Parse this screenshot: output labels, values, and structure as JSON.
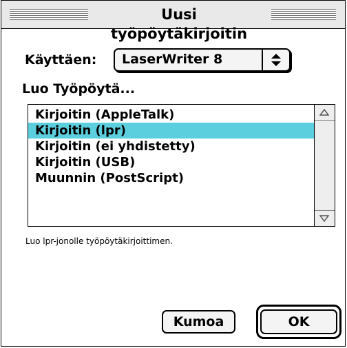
{
  "window": {
    "title": "Uusi työpöytäkirjoitin"
  },
  "using": {
    "label": "Käyttäen:",
    "selected": "LaserWriter 8"
  },
  "create": {
    "label": "Luo Työpöytä..."
  },
  "printer_types": {
    "items": [
      {
        "label": "Kirjoitin (AppleTalk)",
        "selected": false
      },
      {
        "label": "Kirjoitin (lpr)",
        "selected": true
      },
      {
        "label": "Kirjoitin (ei yhdistetty)",
        "selected": false
      },
      {
        "label": "Kirjoitin (USB)",
        "selected": false
      },
      {
        "label": "Muunnin (PostScript)",
        "selected": false
      }
    ]
  },
  "description": "Luo lpr-jonolle työpöytäkirjoittimen.",
  "buttons": {
    "cancel": "Kumoa",
    "ok": "OK"
  },
  "colors": {
    "selection": "#5bcfde"
  },
  "icons": {
    "popup_arrows": "up-down-arrows-icon",
    "scroll_up": "scroll-up-arrow-icon",
    "scroll_down": "scroll-down-arrow-icon"
  }
}
